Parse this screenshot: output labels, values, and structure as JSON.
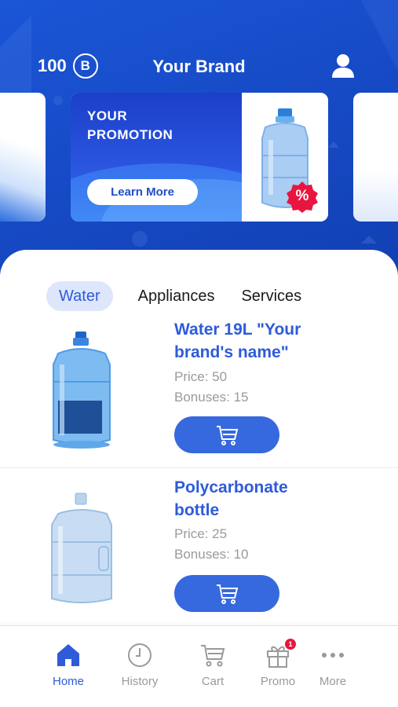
{
  "header": {
    "bonus_count": "100",
    "bonus_symbol": "B",
    "brand_title": "Your Brand"
  },
  "promo": {
    "title_line1": "YOUR",
    "title_line2": "PROMOTION",
    "button_label": "Learn More",
    "badge_symbol": "%"
  },
  "tabs": [
    {
      "label": "Water",
      "active": true
    },
    {
      "label": "Appliances",
      "active": false
    },
    {
      "label": "Services",
      "active": false
    }
  ],
  "products": [
    {
      "name_line1": "Water 19L \"Your",
      "name_line2": "brand's name\"",
      "price": "Price: 50",
      "bonuses": "Bonuses: 15"
    },
    {
      "name_line1": "Polycarbonate",
      "name_line2": "bottle",
      "price": "Price: 25",
      "bonuses": "Bonuses: 10"
    }
  ],
  "nav": {
    "items": [
      {
        "label": "Home",
        "icon": "home-icon",
        "active": true
      },
      {
        "label": "History",
        "icon": "clock-icon",
        "active": false
      },
      {
        "label": "Cart",
        "icon": "cart-icon",
        "active": false
      },
      {
        "label": "Promo",
        "icon": "gift-icon",
        "active": false,
        "badge": "1"
      },
      {
        "label": "More",
        "icon": "more-icon",
        "active": false
      }
    ]
  },
  "colors": {
    "primary": "#3668de",
    "header_bg": "#1b56d6",
    "badge": "#e8163f",
    "muted_text": "#9a9a9a"
  }
}
